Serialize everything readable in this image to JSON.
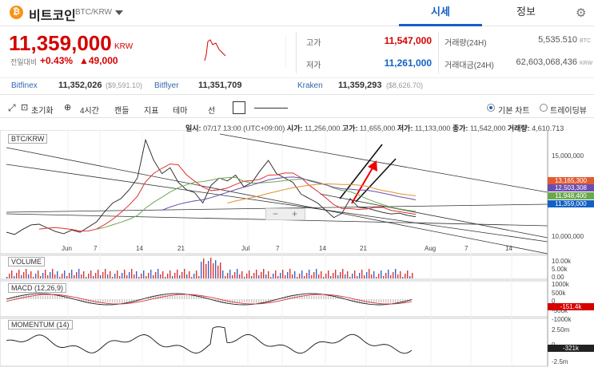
{
  "header": {
    "coin_logo": "₿",
    "coin_name": "비트코인",
    "coin_pair": "BTC/KRW",
    "tabs": [
      {
        "label": "시세"
      },
      {
        "label": "정보"
      }
    ],
    "icons": {
      "dropdown": "chevron-down-icon",
      "settings": "gear-icon"
    }
  },
  "ticker": {
    "price": "11,359,000",
    "unit": "KRW",
    "change_label": "전일대비",
    "change_pct": "+0.43%",
    "change_amt": "▲49,000",
    "high_label": "고가",
    "high_value": "11,547,000",
    "low_label": "저가",
    "low_value": "11,261,000",
    "volume_label": "거래량(24H)",
    "volume_value": "5,535.510",
    "volume_unit": "BTC",
    "amount_label": "거래대금(24H)",
    "amount_value": "62,603,068,436",
    "amount_unit": "KRW"
  },
  "exchanges": [
    {
      "name": "Bitfinex",
      "price": "11,352,026",
      "extra": "($9,591.10)"
    },
    {
      "name": "Bitflyer",
      "price": "11,351,709",
      "extra": ""
    },
    {
      "name": "Kraken",
      "price": "11,359,293",
      "extra": "($8,626.70)"
    }
  ],
  "toolbar": {
    "reset": "초기화",
    "interval": "4시간",
    "candle": "캔들",
    "indicator": "지표",
    "theme": "테마",
    "line": "선",
    "basic_chart": "기본 차트",
    "trading_view": "트레이딩뷰"
  },
  "info_line": {
    "date_label": "일시:",
    "date_value": "07/17 13:00 (UTC+09:00)",
    "open_label": "시가:",
    "open_value": "11,256,000",
    "high_label": "고가:",
    "high_value": "11,655,000",
    "low_label": "저가:",
    "low_value": "11,133,000",
    "close_label": "종가:",
    "close_value": "11,542,000",
    "vol_label": "거래량:",
    "vol_value": "4,610.713"
  },
  "chart_data": {
    "type": "line",
    "panels": [
      {
        "name": "BTC/KRW",
        "x_ticks": [
          "Jun",
          "7",
          "14",
          "21",
          "Jul",
          "7",
          "14",
          "21",
          "Aug",
          "7",
          "14"
        ],
        "y_ticks": [
          "15,000,000",
          "10,000,000"
        ],
        "ylim": [
          9000000,
          17000000
        ],
        "price_tags": [
          {
            "label": "13,165,300",
            "value": 13165300,
            "color": "#e05b35"
          },
          {
            "label": "12,503,308",
            "value": 12503308,
            "color": "#6a4db0"
          },
          {
            "label": "11,948,400",
            "value": 11948400,
            "color": "#6aa84f"
          },
          {
            "label": "11,359,000",
            "value": 11359000,
            "color": "#1261c4"
          }
        ],
        "close_series": [
          10300000,
          10150000,
          10500000,
          10800000,
          10850000,
          10600000,
          10350000,
          10200000,
          10450000,
          10300000,
          10650000,
          11000000,
          11700000,
          12300000,
          12600000,
          13200000,
          14000000,
          16600000,
          15200000,
          14300000,
          14700000,
          13700000,
          13200000,
          13000000,
          12300000,
          13500000,
          14000000,
          13800000,
          14200000,
          13400000,
          13700000,
          14500000,
          15200000,
          14300000,
          14000000,
          13700000,
          12900000,
          12600000,
          12300000,
          11800000,
          11300000,
          11600000,
          12600000,
          12000000,
          11950000,
          11800000,
          11650000,
          11550000,
          11600000,
          11450000,
          11359000
        ]
      },
      {
        "name": "VOLUME",
        "y_ticks": [
          "10.00k",
          "5.00k",
          "0.00"
        ]
      },
      {
        "name": "MACD (12,26,9)",
        "y_ticks": [
          "1000k",
          "500k",
          "0",
          "-500k",
          "-1000k"
        ],
        "tag": "-151.4k"
      },
      {
        "name": "MOMENTUM (14)",
        "y_ticks": [
          "2.50m",
          "0",
          "-2.5m"
        ],
        "tag": "-321k"
      }
    ]
  }
}
